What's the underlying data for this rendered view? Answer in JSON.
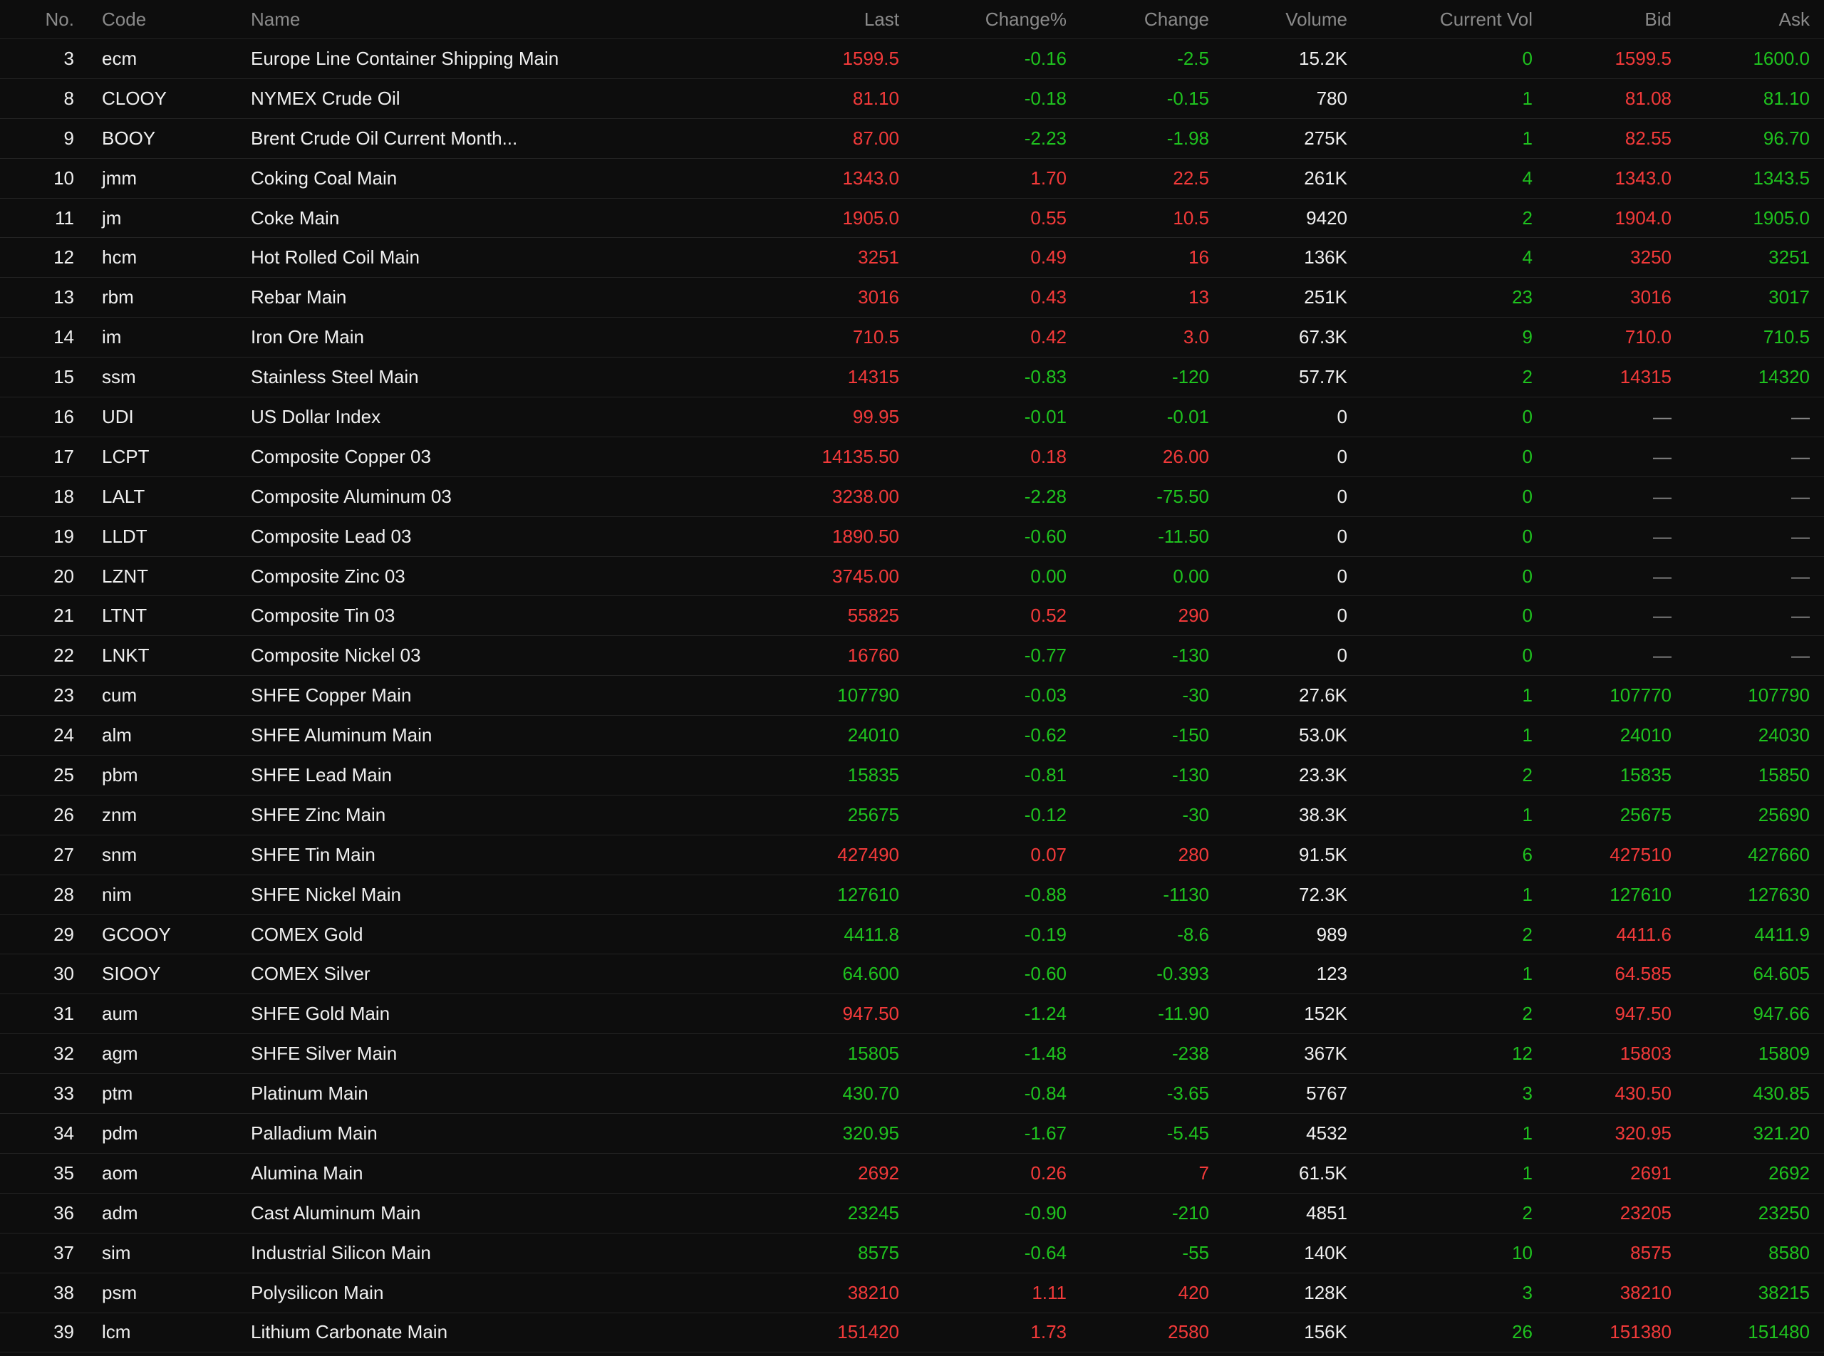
{
  "colors": {
    "up": "#f23a3a",
    "down": "#1fc21f",
    "background": "#0d0d0d",
    "header_text": "#8a8a8a"
  },
  "headers": {
    "no": "No.",
    "code": "Code",
    "name": "Name",
    "last": "Last",
    "change_pct": "Change%",
    "change": "Change",
    "volume": "Volume",
    "current_vol": "Current Vol",
    "bid": "Bid",
    "ask": "Ask"
  },
  "rows": [
    {
      "no": "3",
      "code": "ecm",
      "name": "Europe Line Container Shipping Main",
      "last": "1599.5",
      "change_pct": "-0.16",
      "change": "-2.5",
      "volume": "15.2K",
      "current_vol": "0",
      "bid": "1599.5",
      "ask": "1600.0",
      "last_dir": "up",
      "chg_dir": "down",
      "bid_dir": "up",
      "ask_dir": "down"
    },
    {
      "no": "8",
      "code": "CLOOY",
      "name": "NYMEX Crude Oil",
      "last": "81.10",
      "change_pct": "-0.18",
      "change": "-0.15",
      "volume": "780",
      "current_vol": "1",
      "bid": "81.08",
      "ask": "81.10",
      "last_dir": "up",
      "chg_dir": "down",
      "bid_dir": "up",
      "ask_dir": "down"
    },
    {
      "no": "9",
      "code": "BOOY",
      "name": "Brent Crude Oil Current Month...",
      "last": "87.00",
      "change_pct": "-2.23",
      "change": "-1.98",
      "volume": "275K",
      "current_vol": "1",
      "bid": "82.55",
      "ask": "96.70",
      "last_dir": "up",
      "chg_dir": "down",
      "bid_dir": "up",
      "ask_dir": "down"
    },
    {
      "no": "10",
      "code": "jmm",
      "name": "Coking Coal Main",
      "last": "1343.0",
      "change_pct": "1.70",
      "change": "22.5",
      "volume": "261K",
      "current_vol": "4",
      "bid": "1343.0",
      "ask": "1343.5",
      "last_dir": "up",
      "chg_dir": "up",
      "bid_dir": "up",
      "ask_dir": "down"
    },
    {
      "no": "11",
      "code": "jm",
      "name": "Coke Main",
      "last": "1905.0",
      "change_pct": "0.55",
      "change": "10.5",
      "volume": "9420",
      "current_vol": "2",
      "bid": "1904.0",
      "ask": "1905.0",
      "last_dir": "up",
      "chg_dir": "up",
      "bid_dir": "up",
      "ask_dir": "down"
    },
    {
      "no": "12",
      "code": "hcm",
      "name": "Hot Rolled Coil Main",
      "last": "3251",
      "change_pct": "0.49",
      "change": "16",
      "volume": "136K",
      "current_vol": "4",
      "bid": "3250",
      "ask": "3251",
      "last_dir": "up",
      "chg_dir": "up",
      "bid_dir": "up",
      "ask_dir": "down"
    },
    {
      "no": "13",
      "code": "rbm",
      "name": "Rebar Main",
      "last": "3016",
      "change_pct": "0.43",
      "change": "13",
      "volume": "251K",
      "current_vol": "23",
      "bid": "3016",
      "ask": "3017",
      "last_dir": "up",
      "chg_dir": "up",
      "bid_dir": "up",
      "ask_dir": "down"
    },
    {
      "no": "14",
      "code": "im",
      "name": "Iron Ore Main",
      "last": "710.5",
      "change_pct": "0.42",
      "change": "3.0",
      "volume": "67.3K",
      "current_vol": "9",
      "bid": "710.0",
      "ask": "710.5",
      "last_dir": "up",
      "chg_dir": "up",
      "bid_dir": "up",
      "ask_dir": "down"
    },
    {
      "no": "15",
      "code": "ssm",
      "name": "Stainless Steel Main",
      "last": "14315",
      "change_pct": "-0.83",
      "change": "-120",
      "volume": "57.7K",
      "current_vol": "2",
      "bid": "14315",
      "ask": "14320",
      "last_dir": "up",
      "chg_dir": "down",
      "bid_dir": "up",
      "ask_dir": "down"
    },
    {
      "no": "16",
      "code": "UDI",
      "name": "US Dollar Index",
      "last": "99.95",
      "change_pct": "-0.01",
      "change": "-0.01",
      "volume": "0",
      "current_vol": "0",
      "bid": "—",
      "ask": "—",
      "last_dir": "up",
      "chg_dir": "down",
      "bid_dir": "dash",
      "ask_dir": "dash"
    },
    {
      "no": "17",
      "code": "LCPT",
      "name": "Composite Copper 03",
      "last": "14135.50",
      "change_pct": "0.18",
      "change": "26.00",
      "volume": "0",
      "current_vol": "0",
      "bid": "—",
      "ask": "—",
      "last_dir": "up",
      "chg_dir": "up",
      "bid_dir": "dash",
      "ask_dir": "dash"
    },
    {
      "no": "18",
      "code": "LALT",
      "name": "Composite Aluminum 03",
      "last": "3238.00",
      "change_pct": "-2.28",
      "change": "-75.50",
      "volume": "0",
      "current_vol": "0",
      "bid": "—",
      "ask": "—",
      "last_dir": "up",
      "chg_dir": "down",
      "bid_dir": "dash",
      "ask_dir": "dash"
    },
    {
      "no": "19",
      "code": "LLDT",
      "name": "Composite Lead 03",
      "last": "1890.50",
      "change_pct": "-0.60",
      "change": "-11.50",
      "volume": "0",
      "current_vol": "0",
      "bid": "—",
      "ask": "—",
      "last_dir": "up",
      "chg_dir": "down",
      "bid_dir": "dash",
      "ask_dir": "dash"
    },
    {
      "no": "20",
      "code": "LZNT",
      "name": "Composite Zinc 03",
      "last": "3745.00",
      "change_pct": "0.00",
      "change": "0.00",
      "volume": "0",
      "current_vol": "0",
      "bid": "—",
      "ask": "—",
      "last_dir": "up",
      "chg_dir": "down",
      "bid_dir": "dash",
      "ask_dir": "dash"
    },
    {
      "no": "21",
      "code": "LTNT",
      "name": "Composite Tin 03",
      "last": "55825",
      "change_pct": "0.52",
      "change": "290",
      "volume": "0",
      "current_vol": "0",
      "bid": "—",
      "ask": "—",
      "last_dir": "up",
      "chg_dir": "up",
      "bid_dir": "dash",
      "ask_dir": "dash"
    },
    {
      "no": "22",
      "code": "LNKT",
      "name": "Composite Nickel 03",
      "last": "16760",
      "change_pct": "-0.77",
      "change": "-130",
      "volume": "0",
      "current_vol": "0",
      "bid": "—",
      "ask": "—",
      "last_dir": "up",
      "chg_dir": "down",
      "bid_dir": "dash",
      "ask_dir": "dash"
    },
    {
      "no": "23",
      "code": "cum",
      "name": "SHFE Copper Main",
      "last": "107790",
      "change_pct": "-0.03",
      "change": "-30",
      "volume": "27.6K",
      "current_vol": "1",
      "bid": "107770",
      "ask": "107790",
      "last_dir": "down",
      "chg_dir": "down",
      "bid_dir": "down",
      "ask_dir": "down"
    },
    {
      "no": "24",
      "code": "alm",
      "name": "SHFE Aluminum Main",
      "last": "24010",
      "change_pct": "-0.62",
      "change": "-150",
      "volume": "53.0K",
      "current_vol": "1",
      "bid": "24010",
      "ask": "24030",
      "last_dir": "down",
      "chg_dir": "down",
      "bid_dir": "down",
      "ask_dir": "down"
    },
    {
      "no": "25",
      "code": "pbm",
      "name": "SHFE Lead Main",
      "last": "15835",
      "change_pct": "-0.81",
      "change": "-130",
      "volume": "23.3K",
      "current_vol": "2",
      "bid": "15835",
      "ask": "15850",
      "last_dir": "down",
      "chg_dir": "down",
      "bid_dir": "down",
      "ask_dir": "down"
    },
    {
      "no": "26",
      "code": "znm",
      "name": "SHFE Zinc Main",
      "last": "25675",
      "change_pct": "-0.12",
      "change": "-30",
      "volume": "38.3K",
      "current_vol": "1",
      "bid": "25675",
      "ask": "25690",
      "last_dir": "down",
      "chg_dir": "down",
      "bid_dir": "down",
      "ask_dir": "down"
    },
    {
      "no": "27",
      "code": "snm",
      "name": "SHFE Tin Main",
      "last": "427490",
      "change_pct": "0.07",
      "change": "280",
      "volume": "91.5K",
      "current_vol": "6",
      "bid": "427510",
      "ask": "427660",
      "last_dir": "up",
      "chg_dir": "up",
      "bid_dir": "up",
      "ask_dir": "down"
    },
    {
      "no": "28",
      "code": "nim",
      "name": "SHFE Nickel Main",
      "last": "127610",
      "change_pct": "-0.88",
      "change": "-1130",
      "volume": "72.3K",
      "current_vol": "1",
      "bid": "127610",
      "ask": "127630",
      "last_dir": "down",
      "chg_dir": "down",
      "bid_dir": "down",
      "ask_dir": "down"
    },
    {
      "no": "29",
      "code": "GCOOY",
      "name": "COMEX Gold",
      "last": "4411.8",
      "change_pct": "-0.19",
      "change": "-8.6",
      "volume": "989",
      "current_vol": "2",
      "bid": "4411.6",
      "ask": "4411.9",
      "last_dir": "down",
      "chg_dir": "down",
      "bid_dir": "up",
      "ask_dir": "down"
    },
    {
      "no": "30",
      "code": "SIOOY",
      "name": "COMEX Silver",
      "last": "64.600",
      "change_pct": "-0.60",
      "change": "-0.393",
      "volume": "123",
      "current_vol": "1",
      "bid": "64.585",
      "ask": "64.605",
      "last_dir": "down",
      "chg_dir": "down",
      "bid_dir": "up",
      "ask_dir": "down"
    },
    {
      "no": "31",
      "code": "aum",
      "name": "SHFE Gold Main",
      "last": "947.50",
      "change_pct": "-1.24",
      "change": "-11.90",
      "volume": "152K",
      "current_vol": "2",
      "bid": "947.50",
      "ask": "947.66",
      "last_dir": "up",
      "chg_dir": "down",
      "bid_dir": "up",
      "ask_dir": "down"
    },
    {
      "no": "32",
      "code": "agm",
      "name": "SHFE Silver Main",
      "last": "15805",
      "change_pct": "-1.48",
      "change": "-238",
      "volume": "367K",
      "current_vol": "12",
      "bid": "15803",
      "ask": "15809",
      "last_dir": "down",
      "chg_dir": "down",
      "bid_dir": "up",
      "ask_dir": "down"
    },
    {
      "no": "33",
      "code": "ptm",
      "name": "Platinum Main",
      "last": "430.70",
      "change_pct": "-0.84",
      "change": "-3.65",
      "volume": "5767",
      "current_vol": "3",
      "bid": "430.50",
      "ask": "430.85",
      "last_dir": "down",
      "chg_dir": "down",
      "bid_dir": "up",
      "ask_dir": "down"
    },
    {
      "no": "34",
      "code": "pdm",
      "name": "Palladium Main",
      "last": "320.95",
      "change_pct": "-1.67",
      "change": "-5.45",
      "volume": "4532",
      "current_vol": "1",
      "bid": "320.95",
      "ask": "321.20",
      "last_dir": "down",
      "chg_dir": "down",
      "bid_dir": "up",
      "ask_dir": "down"
    },
    {
      "no": "35",
      "code": "aom",
      "name": "Alumina Main",
      "last": "2692",
      "change_pct": "0.26",
      "change": "7",
      "volume": "61.5K",
      "current_vol": "1",
      "bid": "2691",
      "ask": "2692",
      "last_dir": "up",
      "chg_dir": "up",
      "bid_dir": "up",
      "ask_dir": "down"
    },
    {
      "no": "36",
      "code": "adm",
      "name": "Cast Aluminum Main",
      "last": "23245",
      "change_pct": "-0.90",
      "change": "-210",
      "volume": "4851",
      "current_vol": "2",
      "bid": "23205",
      "ask": "23250",
      "last_dir": "down",
      "chg_dir": "down",
      "bid_dir": "up",
      "ask_dir": "down"
    },
    {
      "no": "37",
      "code": "sim",
      "name": "Industrial Silicon Main",
      "last": "8575",
      "change_pct": "-0.64",
      "change": "-55",
      "volume": "140K",
      "current_vol": "10",
      "bid": "8575",
      "ask": "8580",
      "last_dir": "down",
      "chg_dir": "down",
      "bid_dir": "up",
      "ask_dir": "down"
    },
    {
      "no": "38",
      "code": "psm",
      "name": "Polysilicon Main",
      "last": "38210",
      "change_pct": "1.11",
      "change": "420",
      "volume": "128K",
      "current_vol": "3",
      "bid": "38210",
      "ask": "38215",
      "last_dir": "up",
      "chg_dir": "up",
      "bid_dir": "up",
      "ask_dir": "down"
    },
    {
      "no": "39",
      "code": "lcm",
      "name": "Lithium Carbonate Main",
      "last": "151420",
      "change_pct": "1.73",
      "change": "2580",
      "volume": "156K",
      "current_vol": "26",
      "bid": "151380",
      "ask": "151480",
      "last_dir": "up",
      "chg_dir": "up",
      "bid_dir": "up",
      "ask_dir": "down"
    }
  ]
}
